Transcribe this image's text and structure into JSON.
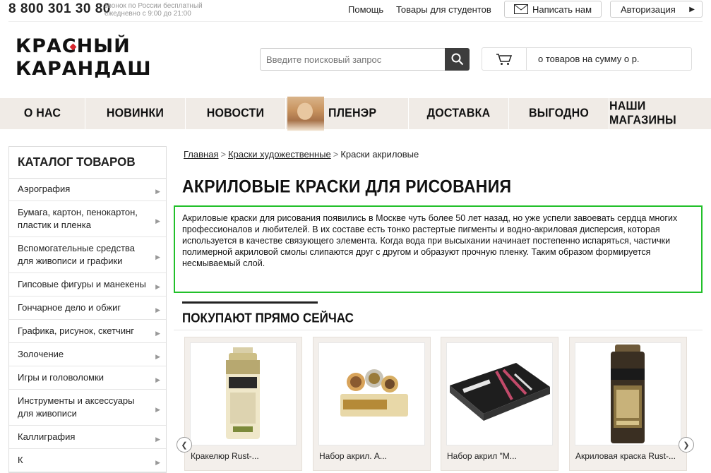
{
  "topbar": {
    "phone": "8 800 301 30 80",
    "phone_note_1": "звонок по России бесплатный",
    "phone_note_2": "ежедневно с 9:00 до 21:00",
    "help": "Помощь",
    "students": "Товары для студентов",
    "write_us": "Написать нам",
    "auth": "Авторизация"
  },
  "logo": {
    "line1": "КРАСНЫЙ",
    "line2": "КАРАНДАШ",
    "accent_color": "#d6252c"
  },
  "search": {
    "placeholder": "Введите поисковый запрос"
  },
  "cart": {
    "text": "о товаров на сумму о р."
  },
  "nav": [
    "О НАС",
    "НОВИНКИ",
    "НОВОСТИ",
    "ПЛЕНЭР",
    "ДОСТАВКА",
    "ВЫГОДНО",
    "НАШИ МАГАЗИНЫ"
  ],
  "sidebar": {
    "title": "КАТАЛОГ ТОВАРОВ",
    "items": [
      [
        "Аэрография"
      ],
      [
        "Бумага, картон, пенокартон,",
        "пластик и пленка"
      ],
      [
        "Вспомогательные средства",
        "для живописи и графики"
      ],
      [
        "Гипсовые фигуры и манекены"
      ],
      [
        "Гончарное дело и обжиг"
      ],
      [
        "Графика, рисунок, скетчинг"
      ],
      [
        "Золочение"
      ],
      [
        "Игры и головоломки"
      ],
      [
        "Инструменты и аксессуары",
        "для живописи"
      ],
      [
        "Каллиграфия"
      ],
      [
        "К"
      ]
    ]
  },
  "breadcrumb": {
    "home": "Главная",
    "parent": "Краски художественные",
    "current": "Краски акриловые",
    "separator": ">"
  },
  "page_title": "АКРИЛОВЫЕ КРАСКИ ДЛЯ РИСОВАНИЯ",
  "description": "Акриловые краски для рисования появились в Москве чуть более 50 лет назад, но уже успели завоевать сердца многих профессионалов и любителей. В их составе есть тонко растертые пигменты и водно-акриловая дисперсия, которая используется в качестве связующего элемента. Когда вода при высыхании начинает постепенно испаряться, частички полимерной акриловой смолы слипаются друг с другом и образуют прочную пленку. Таким образом формируется несмываемый слой.",
  "buy_now": {
    "title": "ПОКУПАЮТ ПРЯМО СЕЙЧАС",
    "products": [
      {
        "name": "Кракелюр Rust-...",
        "image": "spray-can-beige"
      },
      {
        "name": "Набор акрил. А...",
        "image": "paint-jars-set"
      },
      {
        "name": "Набор акрил \"М...",
        "image": "black-acrylic-box"
      },
      {
        "name": "Акриловая краска Rust-...",
        "image": "spray-can-metallic"
      }
    ]
  },
  "colors": {
    "highlight_border": "#22c02a",
    "nav_bg": "#f0ebe6"
  }
}
